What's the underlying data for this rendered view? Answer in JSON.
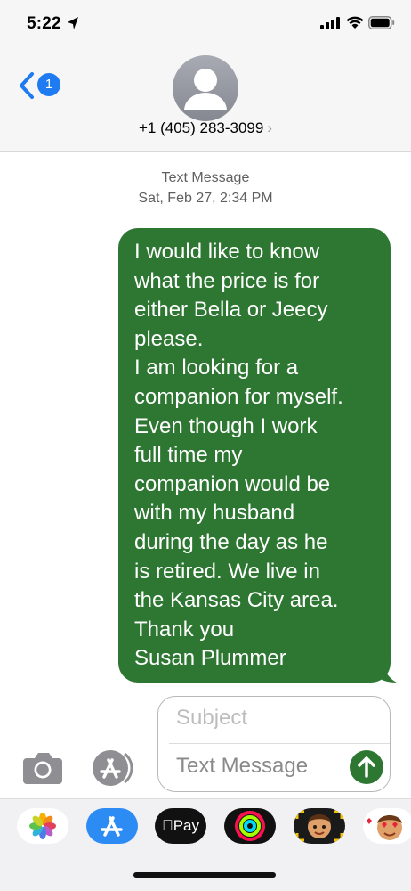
{
  "status_bar": {
    "time": "5:22"
  },
  "header": {
    "back_badge": "1",
    "contact": "+1 (405) 283-3099",
    "contact_chevron": "›"
  },
  "thread": {
    "type_label": "Text Message",
    "date_label": "Sat, Feb 27, 2:34 PM",
    "message": "I would like to know\nwhat the price is for\neither Bella or Jeecy\nplease.\nI am looking for a\ncompanion for myself.\nEven though I work\nfull time my\ncompanion would be\nwith my husband\nduring the day as he\nis retired.  We live in\nthe Kansas City area.\nThank you\nSusan Plummer"
  },
  "compose": {
    "subject_placeholder": "Subject",
    "message_placeholder": "Text Message"
  },
  "drawer": {
    "icons": [
      "photos-icon",
      "app-store-icon",
      "apple-pay-icon",
      "activity-icon",
      "memoji-icon",
      "memoji-stickers-icon"
    ],
    "pay_label": "Pay"
  },
  "colors": {
    "bubble": "#2e7732",
    "badge": "#1f7bf2",
    "header_bg": "#f6f6f6"
  }
}
